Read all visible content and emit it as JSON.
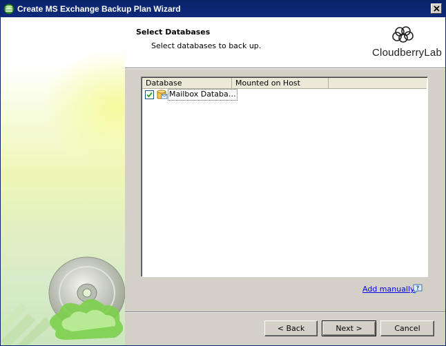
{
  "window": {
    "title": "Create MS Exchange Backup Plan Wizard",
    "close_label": "Close"
  },
  "header": {
    "title": "Select Databases",
    "subtitle": "Select databases to back up.",
    "logo_text": "CloudberryLab"
  },
  "list": {
    "columns": [
      "Database",
      "Mounted on Host",
      ""
    ],
    "rows": [
      {
        "checked": true,
        "database": "Mailbox Databa…",
        "mounted_on_host": ""
      }
    ]
  },
  "add_manually_label": "Add manually",
  "buttons": {
    "back": "< Back",
    "next": "Next >",
    "cancel": "Cancel"
  },
  "colors": {
    "titlebar": "#0a246a",
    "dialog_bg": "#d4d0c8",
    "link": "#0000ee"
  }
}
